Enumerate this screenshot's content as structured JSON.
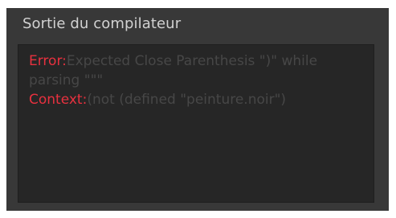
{
  "panel": {
    "title": "Sortie du compilateur"
  },
  "output": {
    "error_label": "Error:",
    "error_message": "Expected Close Parenthesis \")\" while parsing \"\"\"",
    "context_label": "Context:",
    "context_message": "(not (defined \"peinture.noir\")"
  },
  "colors": {
    "panel_bg": "#383838",
    "output_bg": "#262626",
    "label_red": "#e8313f",
    "message_gray": "#474747",
    "title_text": "#d2d2d2"
  }
}
